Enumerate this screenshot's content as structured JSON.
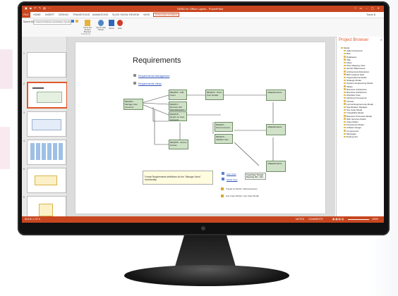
{
  "app": {
    "window_title": "SEBD for Office Layers - PowerPoint",
    "user": "Travis B"
  },
  "tabs": [
    "FILE",
    "HOME",
    "INSERT",
    "DESIGN",
    "TRANSITIONS",
    "ANIMATIONS",
    "SLIDE SHOW",
    "REVIEW",
    "VIEW",
    "Enterprise Architect"
  ],
  "ribbon": {
    "field_label": "Saved Model:",
    "field_value": "C:\\Users\\Tim\\Documents\\Sparx Systems\\EA",
    "buttons": [
      "Close EA Project Browser",
      "Synch with Model",
      "About",
      "Help"
    ],
    "group_label": "Functions"
  },
  "slide_numbers": [
    "1",
    "2",
    "3",
    "4",
    "5",
    "6"
  ],
  "slide": {
    "title": "Requirements",
    "links": [
      "Requirements Management",
      "Requirements Views"
    ],
    "boxes": [
      "REQ003 - Add Users",
      "REQ010 - Store User Details",
      "REQ017 - Remove Old User Accounts",
      "REQ001 - Manage User Accounts",
      "REQ018 - Report on User Accounts",
      "REQ007 - Secure Access",
      "REQ008 - Secure Access",
      "REQ019 - Validate User"
    ],
    "req_labels": [
      "«Requirement»",
      "«Requirement»",
      "«Requirement»"
    ],
    "note": "Formal Requirements definitions for the \"Manage Users\" functionality",
    "small_links": [
      "User View",
      "Model View"
    ],
    "trace_box": "Trace/Trace Through Reporting 003 - 4/22",
    "legend": [
      "Traced by Model / Retrospectives",
      "Use Case Model / Use Case Model"
    ]
  },
  "project_browser": {
    "title": "Project Browser",
    "items": [
      "Model",
      "Agile Framework",
      "BoK",
      "Databases",
      "XML",
      "Kides",
      "Plotz Mapping View",
      "SerOD Wallcensure",
      "Architectural Abstraction",
      "BCP Analysis Stuff",
      "Organizational Model",
      "Strategic Model",
      "Systems Engineering Model",
      "Tables",
      "Business Architecture",
      "Business Architecture",
      "Workflow View",
      "Zachman Framework",
      "TOGAF",
      "Formal Requirements Model",
      "Specification Manager",
      "Use Case Model",
      "Traceability Model",
      "Business Processes Model",
      "Web Services Model",
      "Class Model",
      "Persistence Model",
      "Artifacts Design",
      "Components",
      "Messages",
      "Deployment"
    ]
  },
  "status": {
    "left": "SLIDE 2 OF 6",
    "notes": "NOTES",
    "comments": "COMMENTS",
    "zoom": "100%"
  },
  "colors": {
    "accent": "#c7461f",
    "box_fill": "#cfe2c7"
  }
}
